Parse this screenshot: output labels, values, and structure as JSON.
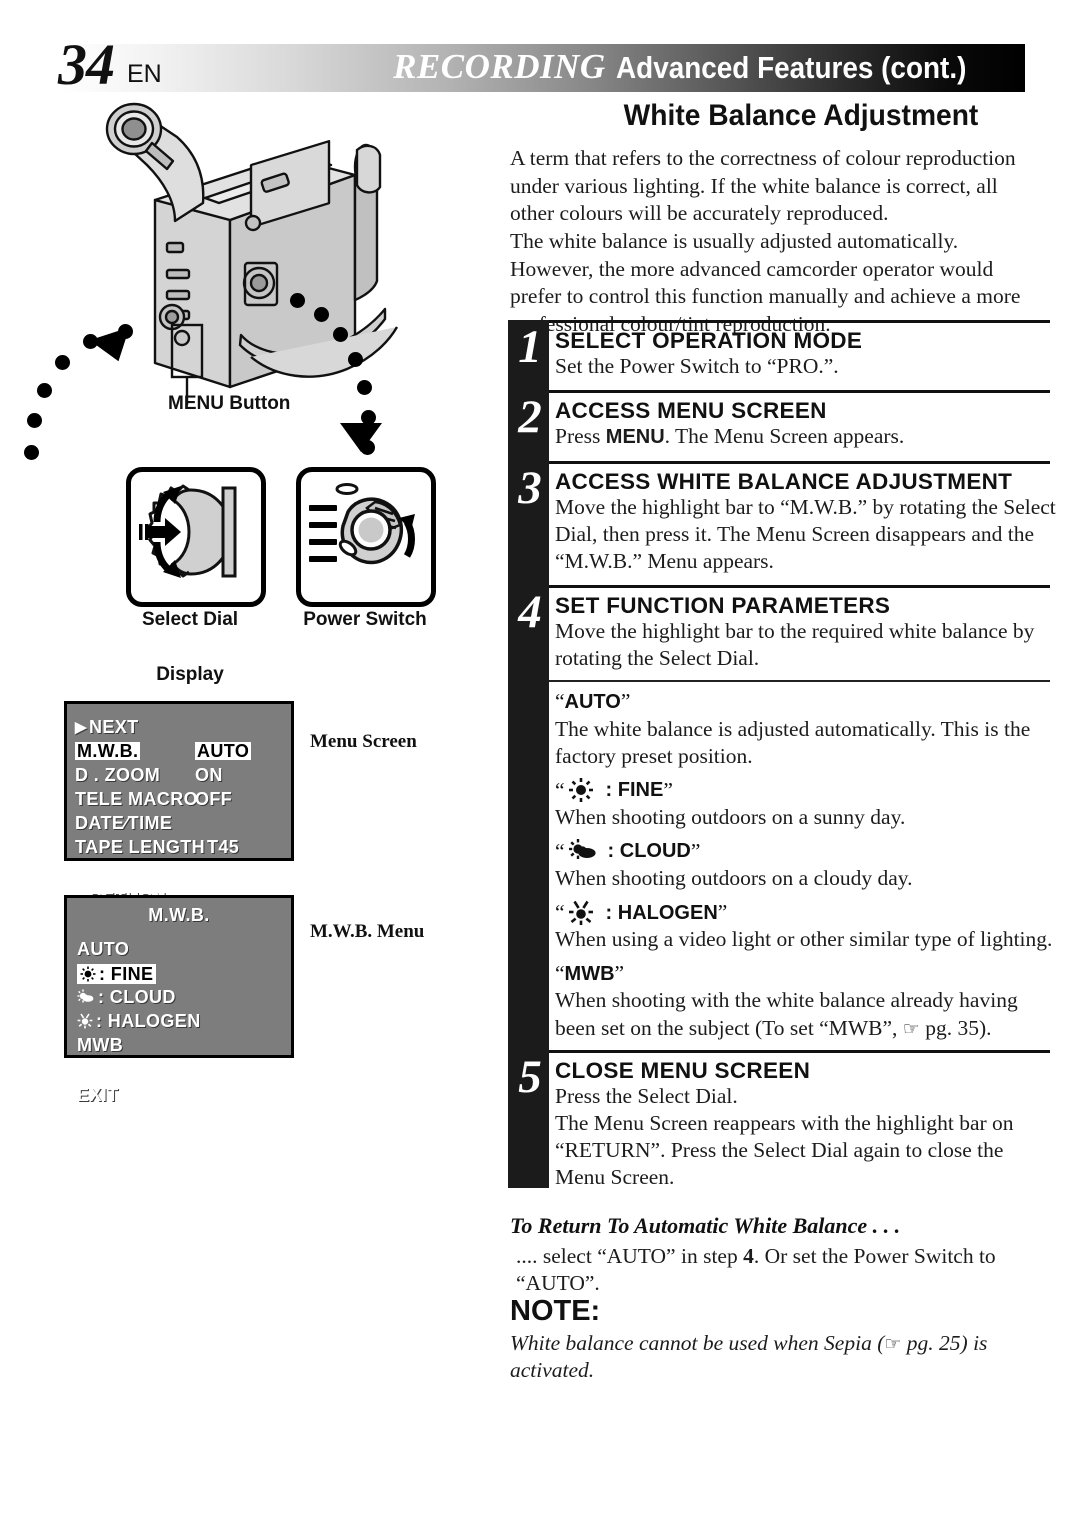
{
  "header": {
    "page_number": "34",
    "language": "EN",
    "title_main": "RECORDING",
    "title_sub": "Advanced Features (cont.)"
  },
  "section": {
    "title": "White Balance Adjustment",
    "intro": "A term that refers to the correctness of colour reproduction under various lighting. If the white balance is correct, all other colours will be accurately reproduced.\nThe white balance is usually adjusted automatically. However, the more advanced camcorder operator would prefer to control this function manually and achieve a more professional colour/tint reproduction."
  },
  "illustration": {
    "menu_button_label": "MENU Button",
    "select_dial_caption": "Select Dial",
    "power_switch_caption": "Power Switch",
    "display_label": "Display",
    "menu_screen_caption": "Menu Screen",
    "mwb_menu_caption": "M.W.B. Menu"
  },
  "menu_screen": {
    "rows": [
      {
        "label": "NEXT",
        "value": "",
        "arrow": true,
        "highlight": false
      },
      {
        "label": "M.W.B.",
        "value": "AUTO",
        "arrow": false,
        "highlight": true
      },
      {
        "label": "D . ZOOM",
        "value": "ON",
        "arrow": false,
        "highlight": false
      },
      {
        "label": "TELE  MACRO",
        "value": "OFF",
        "arrow": false,
        "highlight": false
      },
      {
        "label": "DATE∕TIME",
        "value": "",
        "arrow": false,
        "highlight": false
      },
      {
        "label": "TAPE  LENGTH",
        "value": "T45",
        "arrow": false,
        "highlight": false
      }
    ],
    "footer": "RETURN"
  },
  "mwb_menu": {
    "title": "M.W.B.",
    "rows": [
      {
        "icon": "",
        "label": "AUTO",
        "highlight": false
      },
      {
        "icon": "fine-sun-icon",
        "label": ": FINE",
        "highlight": true
      },
      {
        "icon": "cloud-sun-icon",
        "label": ": CLOUD",
        "highlight": false
      },
      {
        "icon": "halogen-icon",
        "label": ": HALOGEN",
        "highlight": false
      },
      {
        "icon": "",
        "label": "MWB",
        "highlight": false
      }
    ],
    "footer": "EXIT"
  },
  "steps": [
    {
      "num": "1",
      "head": "SELECT OPERATION MODE",
      "body": "Set the Power Switch to “PRO.”."
    },
    {
      "num": "2",
      "head": "ACCESS MENU SCREEN",
      "body_pre": "Press ",
      "body_bold": "MENU",
      "body_post": ". The Menu Screen appears."
    },
    {
      "num": "3",
      "head": "ACCESS WHITE BALANCE ADJUSTMENT",
      "body": "Move the highlight bar to “M.W.B.” by rotating the Select Dial, then press it. The Menu Screen disappears and the “M.W.B.” Menu appears."
    },
    {
      "num": "4",
      "head": "SET FUNCTION PARAMETERS",
      "body": "Move the highlight bar to the required white balance by rotating the Select Dial."
    },
    {
      "num": "5",
      "head": "CLOSE MENU SCREEN",
      "body": "Press the Select Dial.\nThe Menu Screen reappears with the highlight bar on “RETURN”. Press the Select Dial again to close the Menu Screen."
    }
  ],
  "options": [
    {
      "icon": "",
      "quote_open": "“",
      "name": "AUTO",
      "quote_close": "”",
      "body": "The white balance is adjusted automatically. This is the factory preset position."
    },
    {
      "icon": "fine-sun-icon",
      "quote_open": "“",
      "name": ": FINE",
      "quote_close": "”",
      "body": "When shooting outdoors on a sunny day."
    },
    {
      "icon": "cloud-sun-icon",
      "quote_open": "“",
      "name": ": CLOUD",
      "quote_close": "”",
      "body": "When shooting outdoors on a cloudy day."
    },
    {
      "icon": "halogen-icon",
      "quote_open": "“",
      "name": ": HALOGEN",
      "quote_close": "”",
      "body": "When using a video light or other similar type of lighting."
    },
    {
      "icon": "",
      "quote_open": "“",
      "name": "MWB",
      "quote_close": "”",
      "body_pre": "When shooting with the white balance already having been set on the subject (To set “MWB”, ",
      "body_ref": "pg. 35",
      "body_post": ")."
    }
  ],
  "return_auto": {
    "heading": "To Return To Automatic White Balance . . .",
    "body_pre": ".... select “AUTO” in step ",
    "body_bold": "4",
    "body_post": ". Or set the Power Switch to “AUTO”."
  },
  "note": {
    "label": "NOTE:",
    "text_pre": "White balance cannot be used when Sepia (",
    "text_ref": "pg. 25",
    "text_post": ") is activated."
  },
  "colors": {
    "osd_background": "#7d7d7d",
    "osd_text": "#ffffff",
    "step_bar": "#1b1b1b",
    "paper": "#ffffff"
  }
}
